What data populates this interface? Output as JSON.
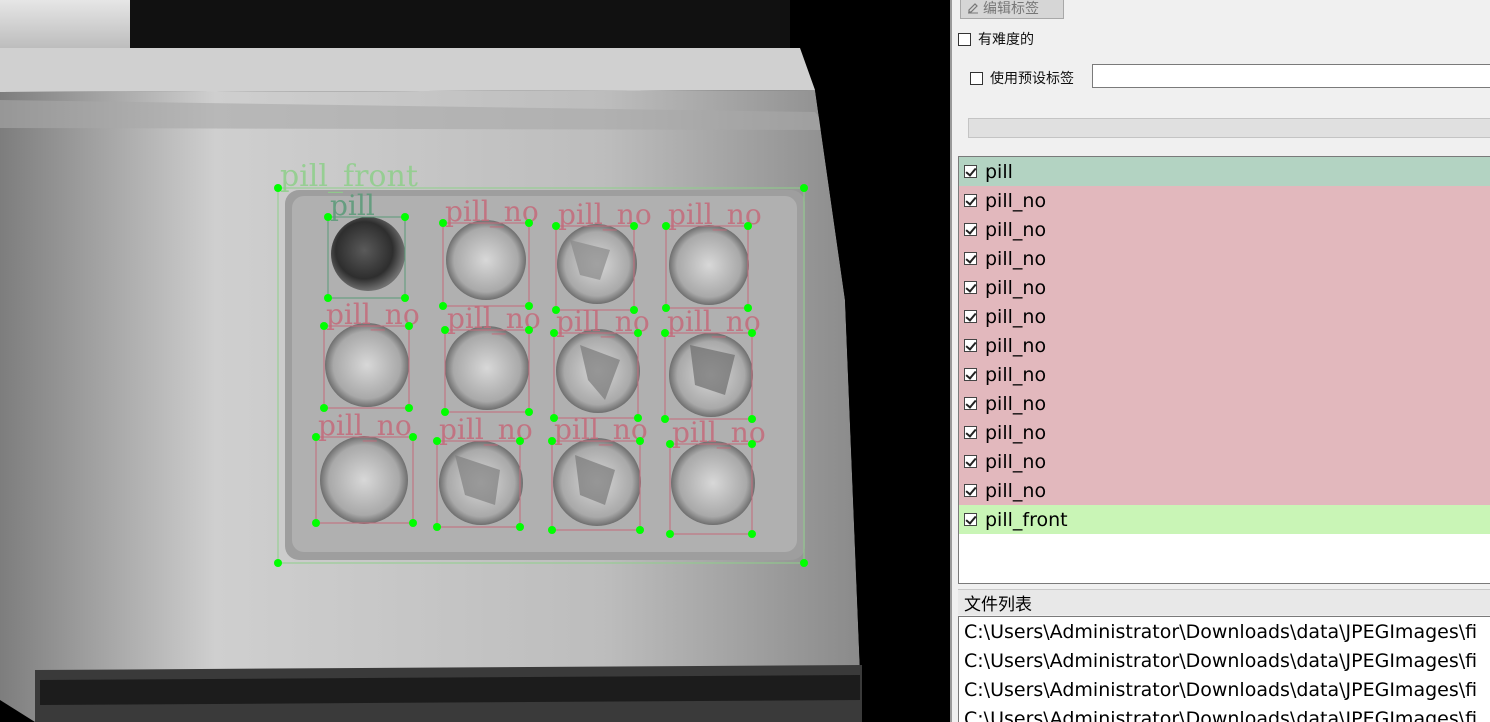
{
  "annotations": {
    "box_color_pill": "#5a9a78",
    "box_color_pill_no": "#c46a7a",
    "box_color_pill_front": "#8ecf8a",
    "vertex_color": "#00ff00",
    "boxes": [
      {
        "label": "pill_front",
        "kind": "pill_front"
      },
      {
        "label": "pill",
        "kind": "pill"
      },
      {
        "label": "pill_no",
        "kind": "pill_no"
      },
      {
        "label": "pill_no",
        "kind": "pill_no"
      },
      {
        "label": "pill_no",
        "kind": "pill_no"
      },
      {
        "label": "pill_no",
        "kind": "pill_no"
      },
      {
        "label": "pill_no",
        "kind": "pill_no"
      },
      {
        "label": "pill_no",
        "kind": "pill_no"
      },
      {
        "label": "pill_no",
        "kind": "pill_no"
      },
      {
        "label": "pill_no",
        "kind": "pill_no"
      },
      {
        "label": "pill_no",
        "kind": "pill_no"
      },
      {
        "label": "pill_no",
        "kind": "pill_no"
      },
      {
        "label": "pill_no",
        "kind": "pill_no"
      }
    ]
  },
  "panel": {
    "edit_label_button": "编辑标签",
    "difficult_label": "有难度的",
    "use_preset_label": "使用预设标签",
    "preset_value": "",
    "file_list_title": "文件列表"
  },
  "labels": [
    {
      "name": "pill",
      "color": "#b3d3c2"
    },
    {
      "name": "pill_no",
      "color": "#e2b8bd"
    },
    {
      "name": "pill_no",
      "color": "#e2b8bd"
    },
    {
      "name": "pill_no",
      "color": "#e2b8bd"
    },
    {
      "name": "pill_no",
      "color": "#e2b8bd"
    },
    {
      "name": "pill_no",
      "color": "#e2b8bd"
    },
    {
      "name": "pill_no",
      "color": "#e2b8bd"
    },
    {
      "name": "pill_no",
      "color": "#e2b8bd"
    },
    {
      "name": "pill_no",
      "color": "#e2b8bd"
    },
    {
      "name": "pill_no",
      "color": "#e2b8bd"
    },
    {
      "name": "pill_no",
      "color": "#e2b8bd"
    },
    {
      "name": "pill_no",
      "color": "#e2b8bd"
    },
    {
      "name": "pill_front",
      "color": "#c9f5b6"
    }
  ],
  "files": [
    "C:\\Users\\Administrator\\Downloads\\data\\JPEGImages\\fi",
    "C:\\Users\\Administrator\\Downloads\\data\\JPEGImages\\fi",
    "C:\\Users\\Administrator\\Downloads\\data\\JPEGImages\\fi",
    "C:\\Users\\Administrator\\Downloads\\data\\JPEGImages\\fi"
  ]
}
